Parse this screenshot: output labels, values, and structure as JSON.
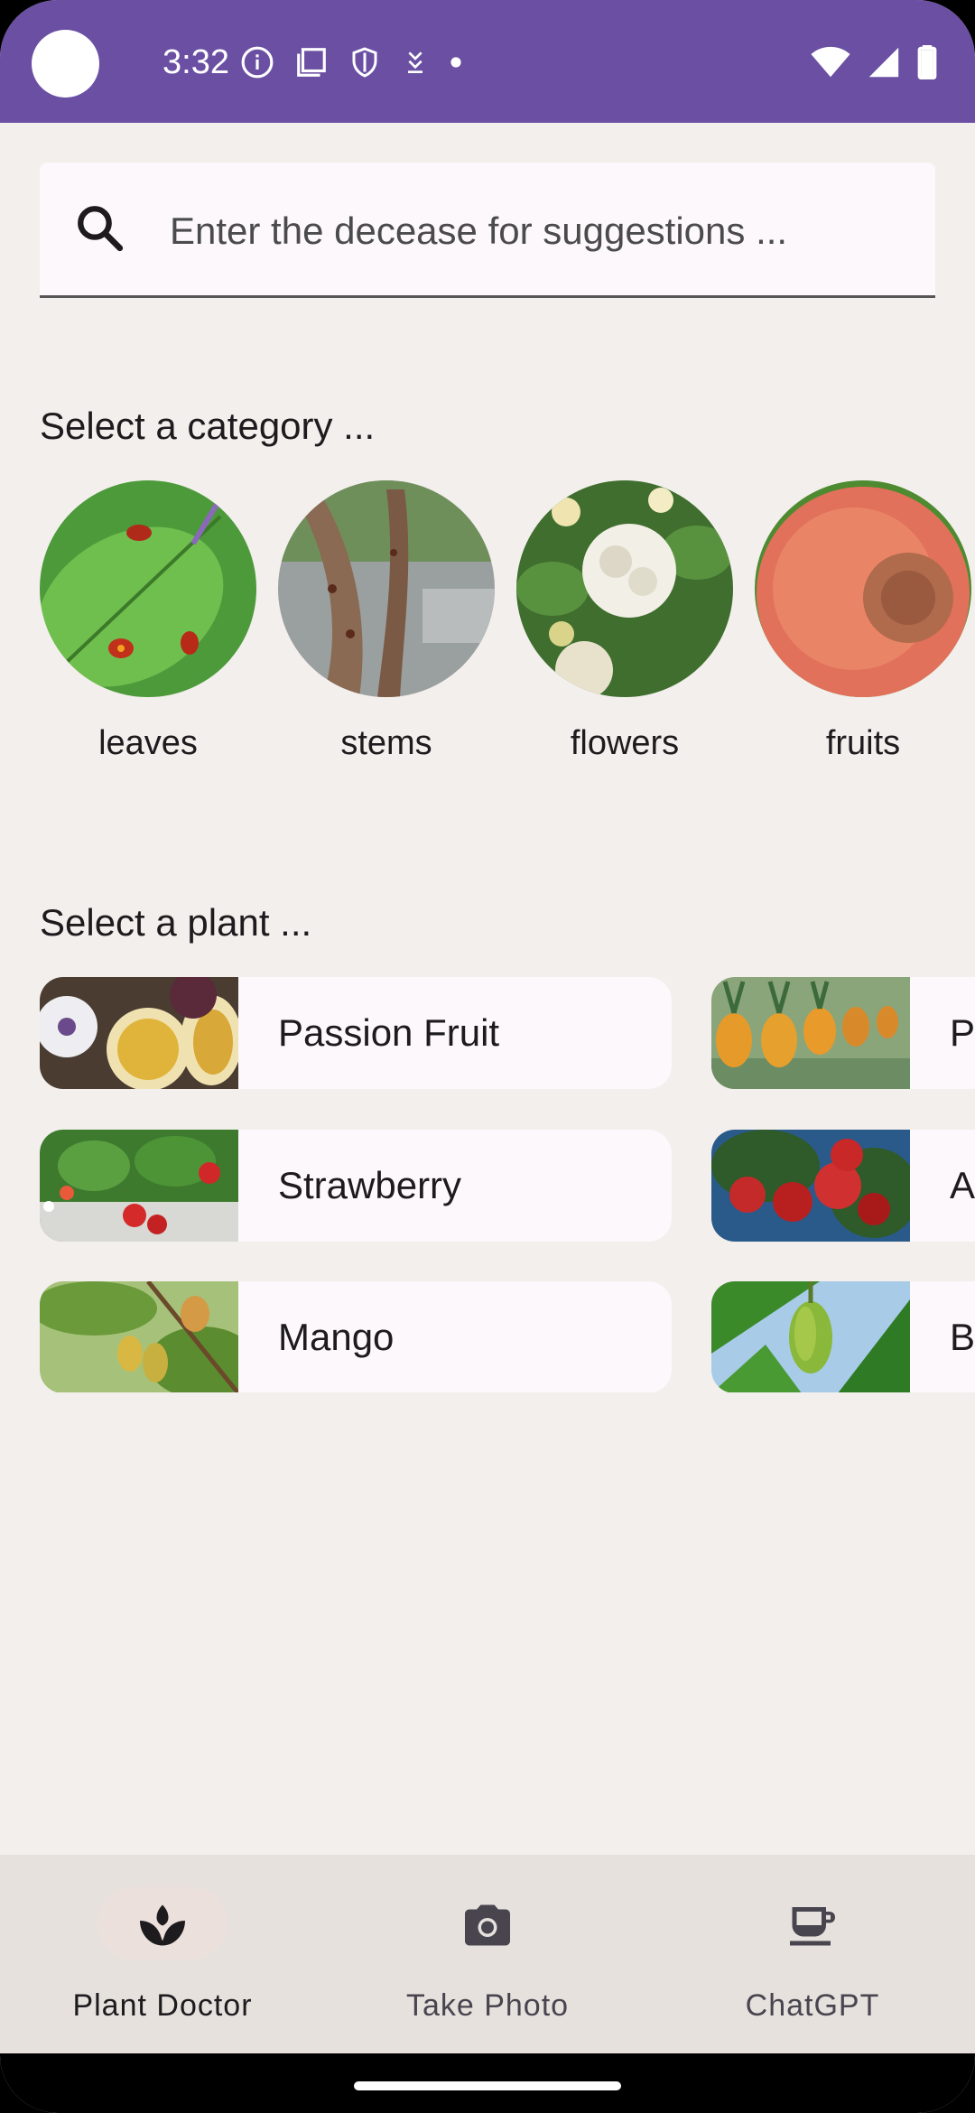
{
  "status_bar": {
    "time": "3:32"
  },
  "search": {
    "placeholder": "Enter the decease for suggestions ..."
  },
  "categories_section": {
    "title": "Select a category ...",
    "items": [
      {
        "label": "leaves"
      },
      {
        "label": "stems"
      },
      {
        "label": "flowers"
      },
      {
        "label": "fruits"
      }
    ]
  },
  "plants_section": {
    "title": "Select a plant ...",
    "rows": [
      {
        "left": "Passion Fruit",
        "right": "P"
      },
      {
        "left": "Strawberry",
        "right": "A"
      },
      {
        "left": "Mango",
        "right": "B"
      }
    ]
  },
  "bottom_nav": {
    "items": [
      {
        "label": "Plant Doctor",
        "icon": "plant-icon",
        "active": true
      },
      {
        "label": "Take Photo",
        "icon": "camera-icon",
        "active": false
      },
      {
        "label": "ChatGPT",
        "icon": "coffee-cup-icon",
        "active": false
      }
    ]
  },
  "colors": {
    "status_bar": "#6a4fa3",
    "background": "#f3efec",
    "card": "#fcf8fb",
    "nav": "#e7e1de"
  }
}
